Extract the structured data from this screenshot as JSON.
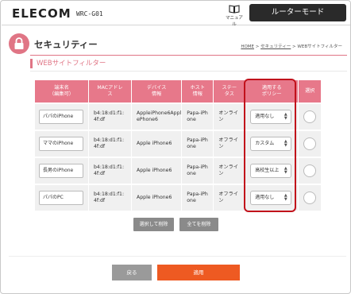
{
  "header": {
    "logo": "ELECOM",
    "model": "WRC-G01",
    "manual_label": "マニュアル",
    "mode_button": "ルーターモード"
  },
  "page": {
    "title": "セキュリティー",
    "breadcrumb": {
      "home": "HOME",
      "sep1": " > ",
      "security": "セキュリティー",
      "sep2": " > ",
      "current": "WEBサイトフィルター"
    },
    "section_title": "WEBサイトフィルター"
  },
  "table": {
    "headers": {
      "terminal_name": [
        "端末名",
        "（編集可）"
      ],
      "mac": [
        "MACアドレ",
        "ス"
      ],
      "device_info": [
        "デバイス",
        "情報"
      ],
      "host_info": [
        "ホスト",
        "情報"
      ],
      "status": [
        "ステー",
        "タス"
      ],
      "policy": [
        "適用する",
        "ポリシー"
      ],
      "select": "選択"
    },
    "rows": [
      {
        "name": "パパのiPhone",
        "mac1": "b4:18:d1:f1:",
        "mac2": "4f:df",
        "device1": "AppleiPhone6Appl",
        "device2": "ePhone6",
        "host1": "Papa-iPh",
        "host2": "one",
        "status1": "オンライ",
        "status2": "ン",
        "policy": "適用なし"
      },
      {
        "name": "ママのiPhone",
        "mac1": "b4:18:d1:f1:",
        "mac2": "4f:df",
        "device1": "Apple iPhone6",
        "device2": "",
        "host1": "Papa-iPh",
        "host2": "one",
        "status1": "オフライ",
        "status2": "ン",
        "policy": "カスタム"
      },
      {
        "name": "長男のiPhone",
        "mac1": "b4:18:d1:f1:",
        "mac2": "4f:df",
        "device1": "Apple iPhone6",
        "device2": "",
        "host1": "Papa-iPh",
        "host2": "one",
        "status1": "オンライ",
        "status2": "ン",
        "policy": "高校生以上"
      },
      {
        "name": "パパのPC",
        "mac1": "b4:18:d1:f1:",
        "mac2": "4f:df",
        "device1": "Apple iPhone6",
        "device2": "",
        "host1": "Papa-iPh",
        "host2": "one",
        "status1": "オフライ",
        "status2": "ン",
        "policy": "適用なし"
      }
    ]
  },
  "actions": {
    "delete_selected": "選択して削除",
    "delete_all": "全てを削除",
    "back": "戻る",
    "apply": "適用"
  },
  "colors": {
    "accent": "#e07585",
    "highlight_box": "#c1111b",
    "apply_button": "#ee5a22",
    "mode_button": "#2a2a2a"
  },
  "icons": {
    "manual": "book-icon",
    "title": "lock-icon",
    "select_arrows": "updown-arrows-icon"
  }
}
